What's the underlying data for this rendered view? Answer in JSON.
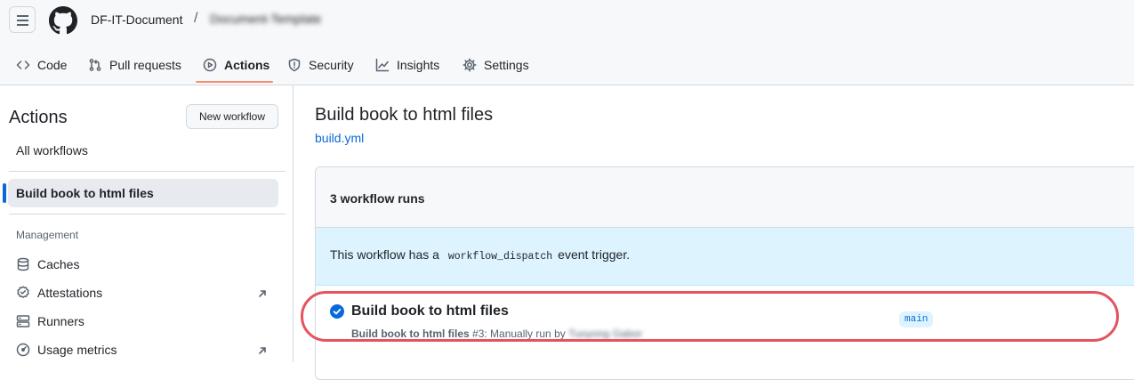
{
  "header": {
    "owner": "DF-IT-Document",
    "separator": "/",
    "repo": "Document-Template"
  },
  "tabs": [
    {
      "label": "Code",
      "icon": "code-icon"
    },
    {
      "label": "Pull requests",
      "icon": "git-pull-request-icon"
    },
    {
      "label": "Actions",
      "icon": "play-icon",
      "active": true
    },
    {
      "label": "Security",
      "icon": "shield-icon"
    },
    {
      "label": "Insights",
      "icon": "graph-icon"
    },
    {
      "label": "Settings",
      "icon": "gear-icon"
    }
  ],
  "sidebar": {
    "title": "Actions",
    "new_workflow_label": "New workflow",
    "all_workflows": "All workflows",
    "selected_workflow": "Build book to html files",
    "management_heading": "Management",
    "management_items": [
      {
        "label": "Caches",
        "icon": "database-icon"
      },
      {
        "label": "Attestations",
        "icon": "verified-icon",
        "external": true
      },
      {
        "label": "Runners",
        "icon": "server-icon"
      },
      {
        "label": "Usage metrics",
        "icon": "meter-icon",
        "external": true
      }
    ]
  },
  "main": {
    "workflow_title": "Build book to html files",
    "workflow_file": "build.yml",
    "runs_count": "3 workflow runs",
    "dispatch_prefix": "This workflow has a",
    "dispatch_code": "workflow_dispatch",
    "dispatch_suffix": "event trigger.",
    "run": {
      "title": "Build book to html files",
      "meta_workflow": "Build book to html files",
      "meta_detail": "#3: Manually run by",
      "meta_user": "Tuoyong Gabor",
      "branch": "main",
      "status": "success"
    }
  },
  "colors": {
    "accent_blue": "#0969da",
    "tab_underline": "#fd8c73",
    "annotation_red": "#e5535f"
  }
}
